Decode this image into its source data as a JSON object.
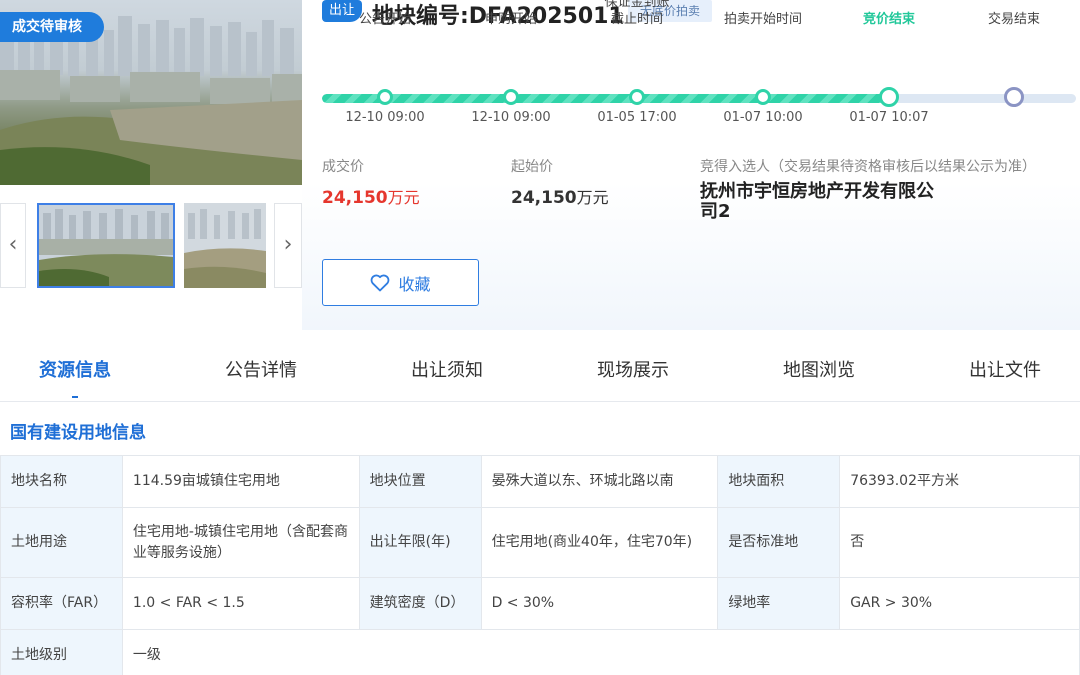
{
  "gallery": {
    "status_tag": "成交待审核",
    "prev_icon": "chevron-left-icon",
    "next_icon": "chevron-right-icon",
    "prev_glyph": "‹",
    "next_glyph": "›"
  },
  "header": {
    "type_badge": "出让",
    "title": "地块编号:DFA2025011",
    "auction_badge": "无底价拍卖"
  },
  "timeline": {
    "completed_fraction": 0.75,
    "steps": [
      {
        "label": "公告开始",
        "time": "12-10 09:00",
        "state": "done"
      },
      {
        "label": "申购开始",
        "time": "12-10 09:00",
        "state": "done"
      },
      {
        "label": "保证金到账\n截止时间",
        "time": "01-05 17:00",
        "state": "done"
      },
      {
        "label": "拍卖开始时间",
        "time": "01-07 10:00",
        "state": "done"
      },
      {
        "label": "竞价结束",
        "time": "01-07 10:07",
        "state": "current"
      },
      {
        "label": "交易结束",
        "time": "",
        "state": "pending"
      }
    ]
  },
  "prices": {
    "deal_label": "成交价",
    "deal_value": "24,150",
    "deal_unit": "万元",
    "start_label": "起始价",
    "start_value": "24,150",
    "start_unit": "万元",
    "winner_label": "竞得入选人（交易结果待资格审核后以结果公示为准）",
    "winner_name": "抚州市宇恒房地产开发有限公司2"
  },
  "favorite": {
    "label": "收藏",
    "icon": "heart-icon"
  },
  "tabs": [
    "资源信息",
    "公告详情",
    "出让须知",
    "现场展示",
    "地图浏览",
    "出让文件"
  ],
  "active_tab": 0,
  "section_title": "国有建设用地信息",
  "land_info": {
    "rows": [
      [
        {
          "k": "地块名称",
          "v": "114.59亩城镇住宅用地"
        },
        {
          "k": "地块位置",
          "v": "晏殊大道以东、环城北路以南"
        },
        {
          "k": "地块面积",
          "v": "76393.02平方米"
        }
      ],
      [
        {
          "k": "土地用途",
          "v": "住宅用地-城镇住宅用地（含配套商业等服务设施）"
        },
        {
          "k": "出让年限(年)",
          "v": "住宅用地(商业40年，住宅70年)"
        },
        {
          "k": "是否标准地",
          "v": "否"
        }
      ],
      [
        {
          "k": "容积率（FAR）",
          "v": "1.0 < FAR < 1.5"
        },
        {
          "k": "建筑密度（D）",
          "v": "D < 30%"
        },
        {
          "k": "绿地率",
          "v": "GAR > 30%"
        }
      ],
      [
        {
          "k": "土地级别",
          "v": "一级"
        }
      ]
    ]
  }
}
